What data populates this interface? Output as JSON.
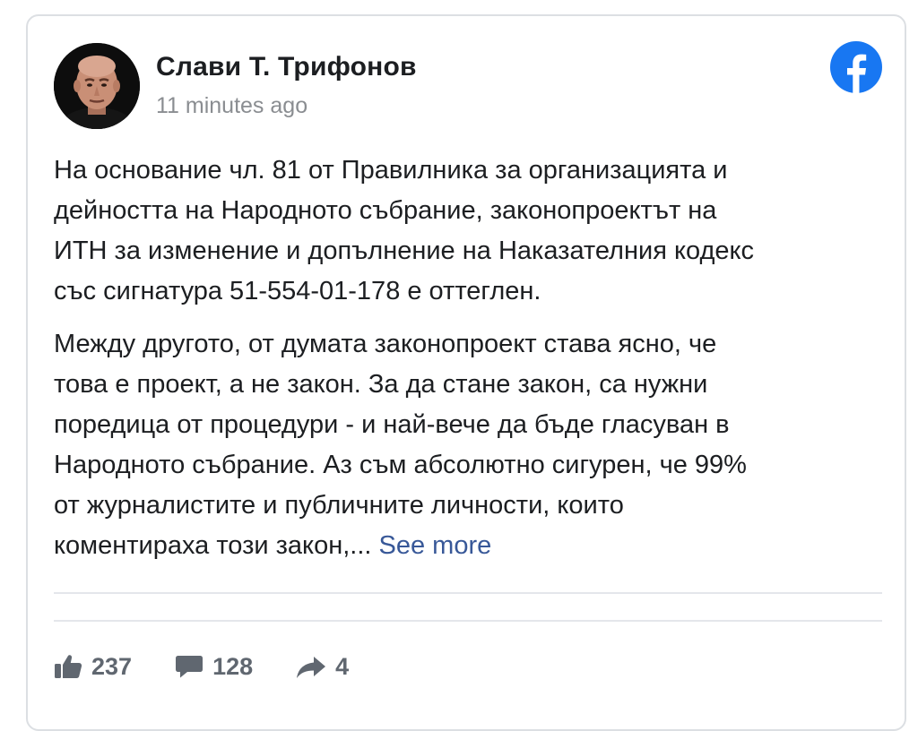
{
  "post": {
    "author": "Слави Т. Трифонов",
    "time": "11 minutes ago",
    "paragraphs": [
      "На основание чл. 81 от Правилника за организацията и\nдейността на Народното събрание, законопроектът на\nИТН за изменение и допълнение на Наказателния кодекс\nсъс сигнатура 51-554-01-178 е оттеглен.",
      "Между другото, от думата законопроект става ясно, че\nтова е проект, а не закон. За да стане закон, са нужни\nпоредица от процедури - и най-вече да бъде гласуван в\nНародното събрание. Аз съм абсолютно сигурен, че 99%\nот журналистите и публичните личности, които\nкоментираха този закон,... "
    ],
    "see_more": "See more"
  },
  "stats": {
    "likes": "237",
    "comments": "128",
    "shares": "4"
  },
  "icons": {
    "logo": "facebook-logo-icon",
    "like": "thumbs-up-icon",
    "comment": "comment-bubble-icon",
    "share": "share-arrow-icon"
  },
  "colors": {
    "facebook_blue": "#1877f2",
    "link": "#385898",
    "text": "#1c1e21",
    "muted": "#8a8d91",
    "stat": "#606770"
  }
}
